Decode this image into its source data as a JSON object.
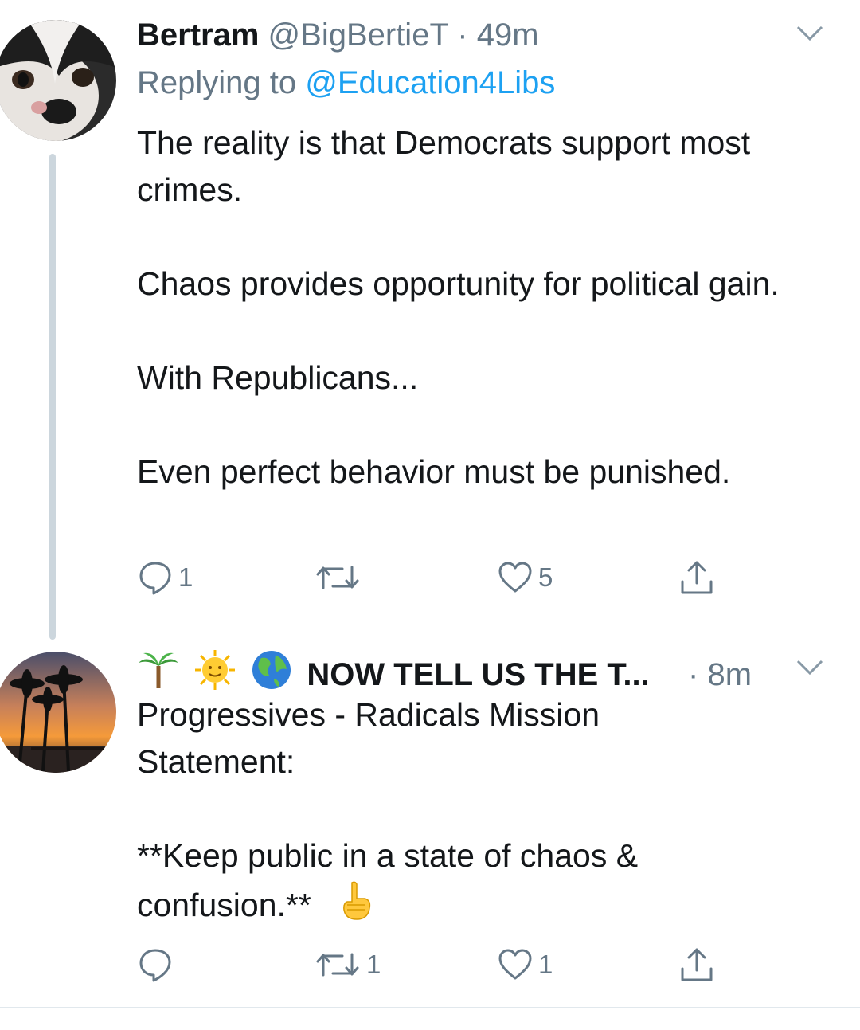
{
  "tweets": [
    {
      "name": "Bertram",
      "handle": "@BigBertieT",
      "separator": "·",
      "time": "49m",
      "reply_prefix": "Replying to",
      "reply_mention": "@Education4Libs",
      "paragraphs": [
        "The reality is that Democrats support most crimes.",
        "Chaos provides opportunity for political gain.",
        "With Republicans...",
        "Even perfect behavior must be punished."
      ],
      "counts": {
        "replies": "1",
        "retweets": "",
        "likes": "5"
      },
      "avatar_icon": "cat-avatar",
      "icons": [
        "reply-icon",
        "retweet-icon",
        "like-icon",
        "share-icon",
        "chevron-down-icon"
      ]
    },
    {
      "name_emojis": [
        "palm-tree-emoji",
        "sun-emoji",
        "globe-emoji"
      ],
      "name": "NOW TELL US THE T...",
      "separator": "·",
      "time": "8m",
      "paragraphs": [
        "Progressives - Radicals Mission Statement:",
        "**Keep public in a state of chaos & confusion.**"
      ],
      "trailing_emoji": "pointing-up-emoji",
      "counts": {
        "replies": "",
        "retweets": "1",
        "likes": "1"
      },
      "avatar_icon": "sunset-palms-avatar"
    }
  ],
  "colors": {
    "text": "#14171a",
    "secondary": "#657786",
    "link": "#1da1f2",
    "thread_line": "#ccd6dd",
    "divider": "#e1e8ed"
  }
}
